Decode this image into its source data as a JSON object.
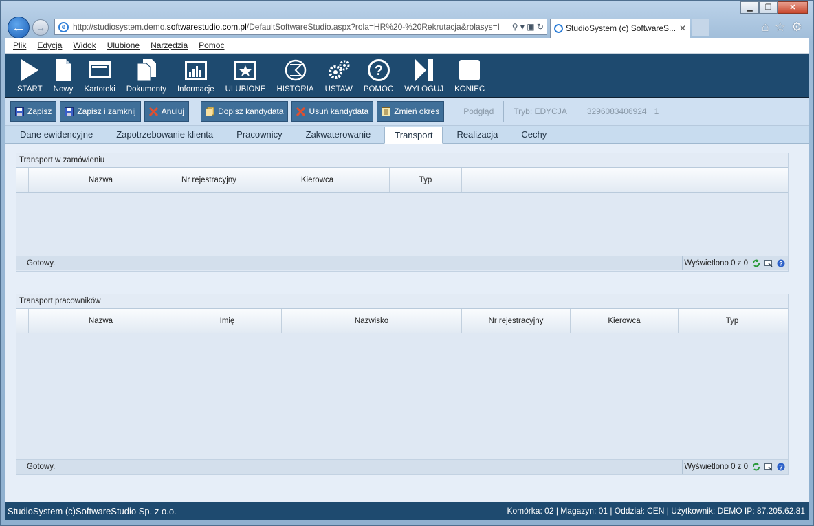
{
  "browser": {
    "url_prefix": "http://studiosystem.demo.",
    "url_host": "softwarestudio.com.pl",
    "url_rest": "/DefaultSoftwareStudio.aspx?rola=HR%20-%20Rekrutacja&rolasys=I",
    "tab_title": "StudioSystem (c) SoftwareS...",
    "menu": [
      "Plik",
      "Edycja",
      "Widok",
      "Ulubione",
      "Narzędzia",
      "Pomoc"
    ]
  },
  "toolbar": [
    {
      "label": "START",
      "icon": "play-icon"
    },
    {
      "label": "Nowy",
      "icon": "document-icon"
    },
    {
      "label": "Kartoteki",
      "icon": "window-icon"
    },
    {
      "label": "Dokumenty",
      "icon": "documents-icon"
    },
    {
      "label": "Informacje",
      "icon": "chart-icon"
    },
    {
      "label": "ULUBIONE",
      "icon": "star-icon"
    },
    {
      "label": "HISTORIA",
      "icon": "history-icon"
    },
    {
      "label": "USTAW",
      "icon": "gears-icon"
    },
    {
      "label": "POMOC",
      "icon": "help-icon"
    },
    {
      "label": "WYLOGUJ",
      "icon": "logout-icon"
    },
    {
      "label": "KONIEC",
      "icon": "stop-icon"
    }
  ],
  "actions": {
    "save": "Zapisz",
    "save_close": "Zapisz i zamknij",
    "cancel": "Anuluj",
    "add_candidate": "Dopisz kandydata",
    "remove_candidate": "Usuń kandydata",
    "change_period": "Zmień okres",
    "preview": "Podgląd",
    "mode": "Tryb: EDYCJA",
    "record_id": "3296083406924",
    "record_no": "1"
  },
  "tabs": [
    "Dane ewidencyjne",
    "Zapotrzebowanie klienta",
    "Pracownicy",
    "Zakwaterowanie",
    "Transport",
    "Realizacja",
    "Cechy"
  ],
  "active_tab": "Transport",
  "grid1": {
    "title": "Transport w zamówieniu",
    "columns": [
      "Nazwa",
      "Nr rejestracyjny",
      "Kierowca",
      "Typ"
    ],
    "status": "Gotowy.",
    "count": "Wyświetlono 0 z 0"
  },
  "grid2": {
    "title": "Transport pracowników",
    "columns": [
      "Nazwa",
      "Imię",
      "Nazwisko",
      "Nr rejestracyjny",
      "Kierowca",
      "Typ"
    ],
    "status": "Gotowy.",
    "count": "Wyświetlono 0 z 0"
  },
  "statusbar": {
    "left": "StudioSystem (c)SoftwareStudio Sp. z o.o.",
    "right": "Komórka: 02 | Magazyn: 01 | Oddział: CEN | Użytkownik: DEMO IP: 87.205.62.81"
  },
  "colors": {
    "toolbar_bg": "#1e4a6f",
    "button_bg": "#3f6f99",
    "tab_bar": "#c8dcef"
  }
}
